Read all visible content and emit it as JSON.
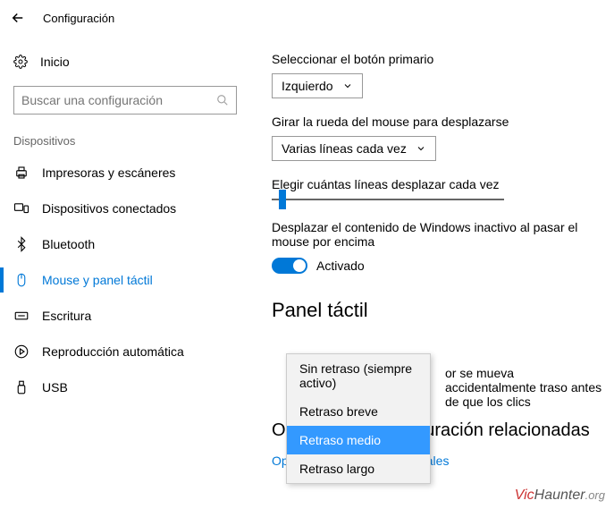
{
  "header": {
    "title": "Configuración"
  },
  "sidebar": {
    "home": "Inicio",
    "search_placeholder": "Buscar una configuración",
    "category": "Dispositivos",
    "items": [
      {
        "label": "Impresoras y escáneres"
      },
      {
        "label": "Dispositivos conectados"
      },
      {
        "label": "Bluetooth"
      },
      {
        "label": "Mouse y panel táctil"
      },
      {
        "label": "Escritura"
      },
      {
        "label": "Reproducción automática"
      },
      {
        "label": "USB"
      }
    ]
  },
  "main": {
    "primary_button_label": "Seleccionar el botón primario",
    "primary_button_value": "Izquierdo",
    "wheel_label": "Girar la rueda del mouse para desplazarse",
    "wheel_value": "Varias líneas cada vez",
    "lines_label": "Elegir cuántas líneas desplazar cada vez",
    "inactive_scroll_label": "Desplazar el contenido de Windows inactivo al pasar el mouse por encima",
    "toggle_state": "Activado",
    "touchpad_heading": "Panel táctil",
    "touchpad_partial_text": "or se mueva accidentalmente traso antes de que los clics",
    "related_heading": "Opciones de configuración relacionadas",
    "related_link": "Opciones de mouse adicionales"
  },
  "popup": {
    "options": [
      "Sin retraso (siempre activo)",
      "Retraso breve",
      "Retraso medio",
      "Retraso largo"
    ],
    "selected_index": 2
  },
  "watermark": {
    "a": "Vic",
    "b": "Haunter",
    "c": ".org"
  }
}
